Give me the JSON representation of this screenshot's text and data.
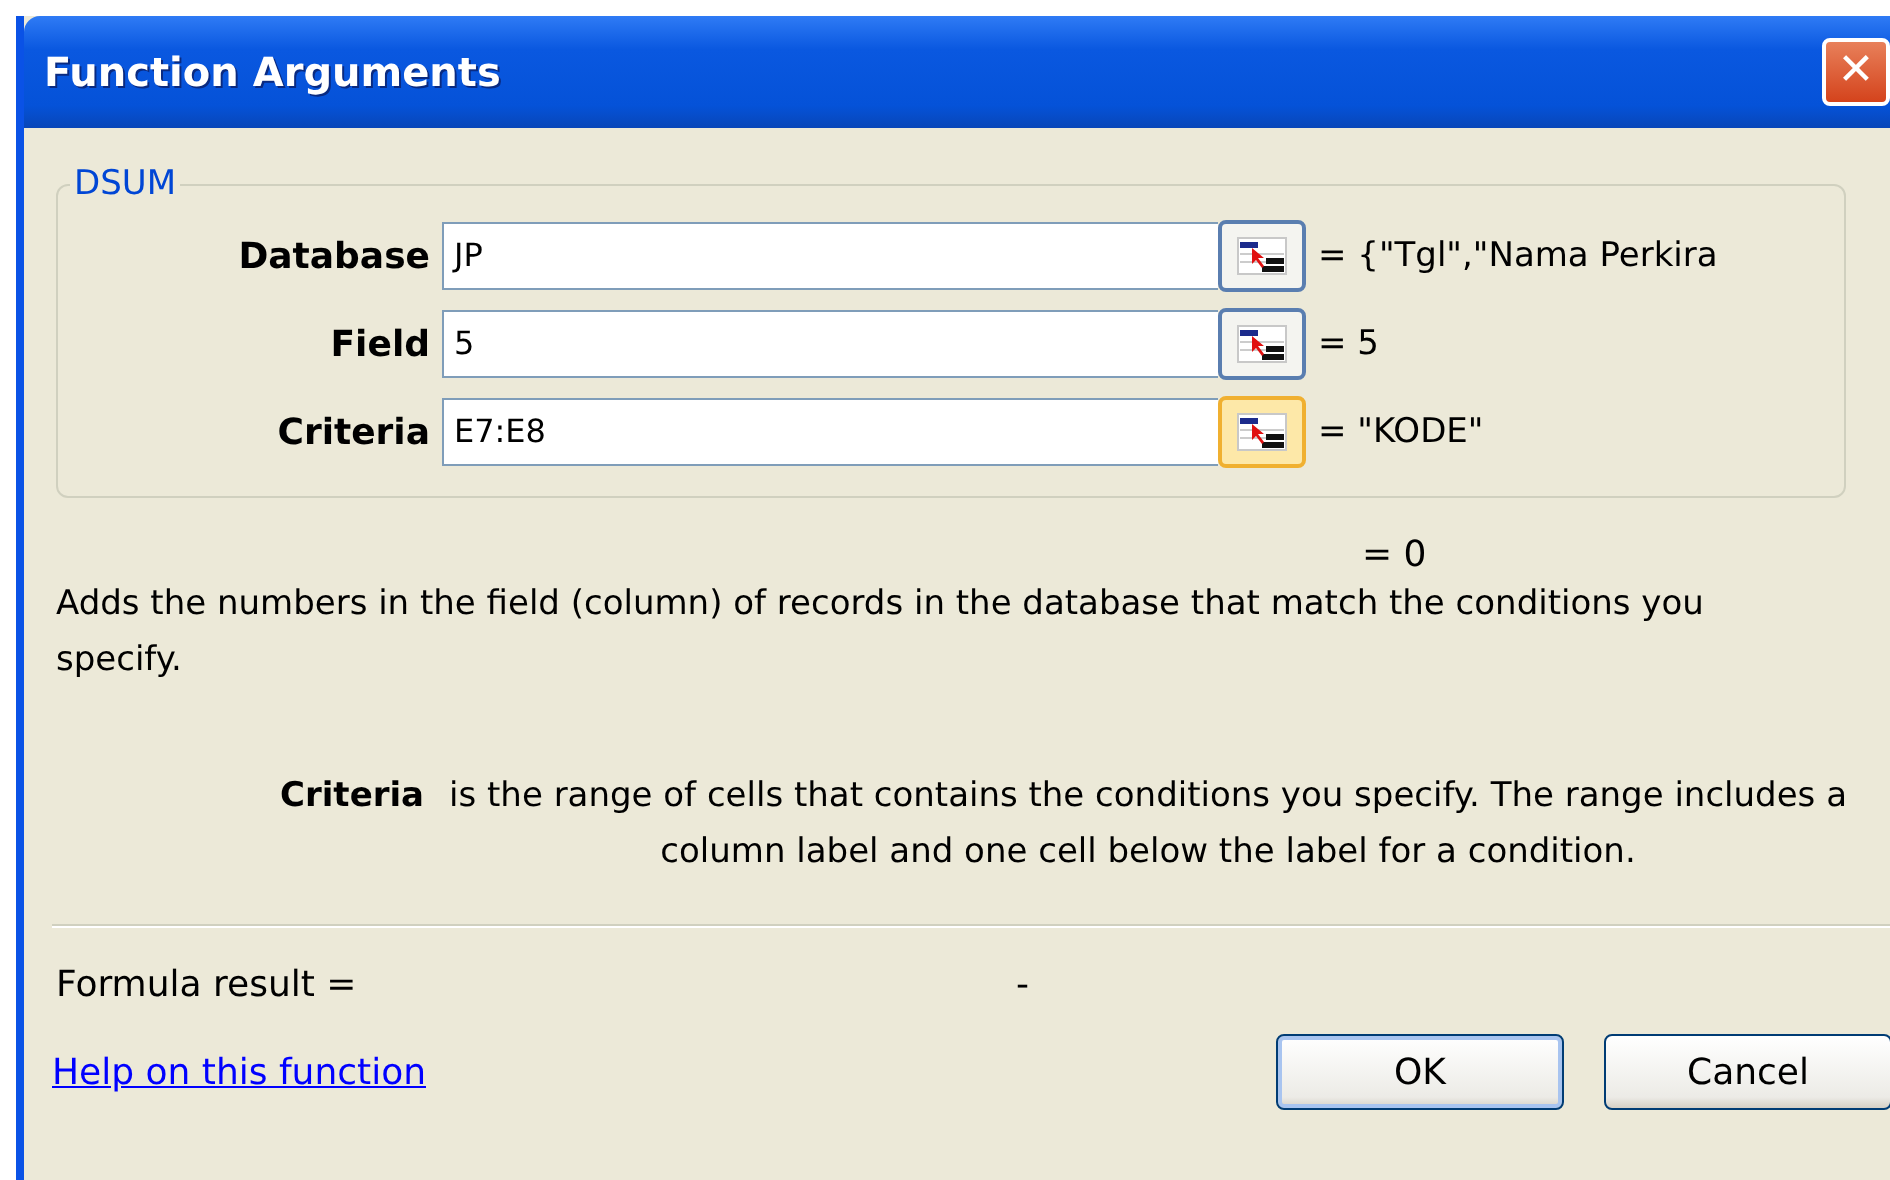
{
  "window": {
    "title": "Function Arguments",
    "close": "✕"
  },
  "group": {
    "title": "DSUM",
    "arguments": [
      {
        "label": "Database",
        "value": "JP",
        "result": "= {\"Tgl\",\"Nama Perkira",
        "highlighted": false
      },
      {
        "label": "Field",
        "value": "5",
        "result": "= 5",
        "highlighted": false
      },
      {
        "label": "Criteria",
        "value": "E7:E8",
        "result": "= \"KODE\"",
        "highlighted": true
      }
    ]
  },
  "total": "= 0",
  "description": "Adds the numbers in the field (column) of records in the database that match the conditions you specify.",
  "argument_help": {
    "name": "Criteria",
    "text": "is the range of cells that contains the conditions you specify. The range includes a column label and one cell below the label for a condition."
  },
  "formula_result": {
    "label": "Formula result =",
    "value": "-"
  },
  "help_link": "Help on this function",
  "buttons": [
    {
      "label": "OK",
      "default": true
    },
    {
      "label": "Cancel",
      "default": false
    }
  ]
}
